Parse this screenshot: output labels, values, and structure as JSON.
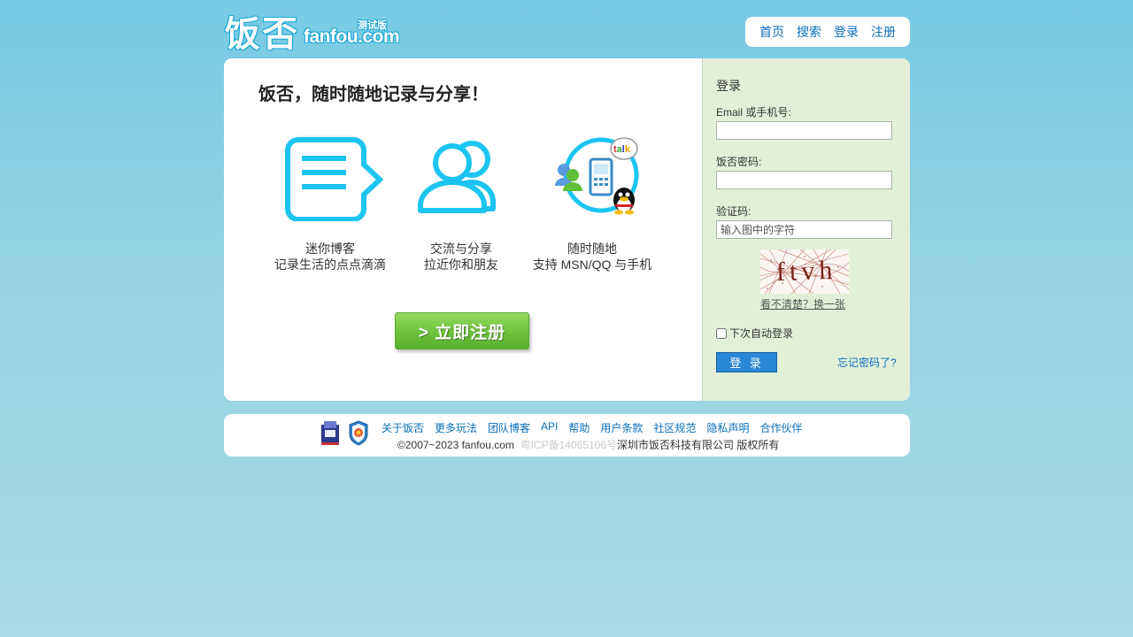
{
  "brand": {
    "logo_cn": "饭否",
    "logo_en": "fanfou.com",
    "logo_tag": "测试版"
  },
  "topnav": {
    "items": [
      "首页",
      "搜索",
      "登录",
      "注册"
    ]
  },
  "intro": {
    "slogan": "饭否，随时随地记录与分享！",
    "features": [
      {
        "icon": "message-bubble-icon",
        "line1": "迷你博客",
        "line2": "记录生活的点点滴滴"
      },
      {
        "icon": "friends-icon",
        "line1": "交流与分享",
        "line2": "拉近你和朋友"
      },
      {
        "icon": "mobile-im-icon",
        "line1": "随时随地",
        "line2": "支持 MSN/QQ 与手机"
      }
    ],
    "signup_label": "> 立即注册"
  },
  "login": {
    "title": "登录",
    "email_label": "Email 或手机号:",
    "email_value": "",
    "password_label": "饭否密码:",
    "password_value": "",
    "captcha_label": "验证码:",
    "captcha_placeholder": "输入图中的字符",
    "captcha_text": "ftvh",
    "refresh_label": "看不清楚？换一张",
    "remember_label": "下次自动登录",
    "submit_label": "登 录",
    "forgot_label": "忘记密码了?"
  },
  "footer": {
    "links": [
      "关于饭否",
      "更多玩法",
      "团队博客",
      "API",
      "帮助",
      "用户条款",
      "社区规范",
      "隐私声明",
      "合作伙伴"
    ],
    "copyright": "©2007~2023 fanfou.com",
    "icp": "粤ICP备14065106号",
    "company": "深圳市饭否科技有限公司 版权所有"
  },
  "colors": {
    "accent": "#25b7e8",
    "link": "#0a6fb8",
    "signup_green": "#6cc23c",
    "login_panel": "#e2f0da",
    "login_button": "#2a87d6"
  }
}
